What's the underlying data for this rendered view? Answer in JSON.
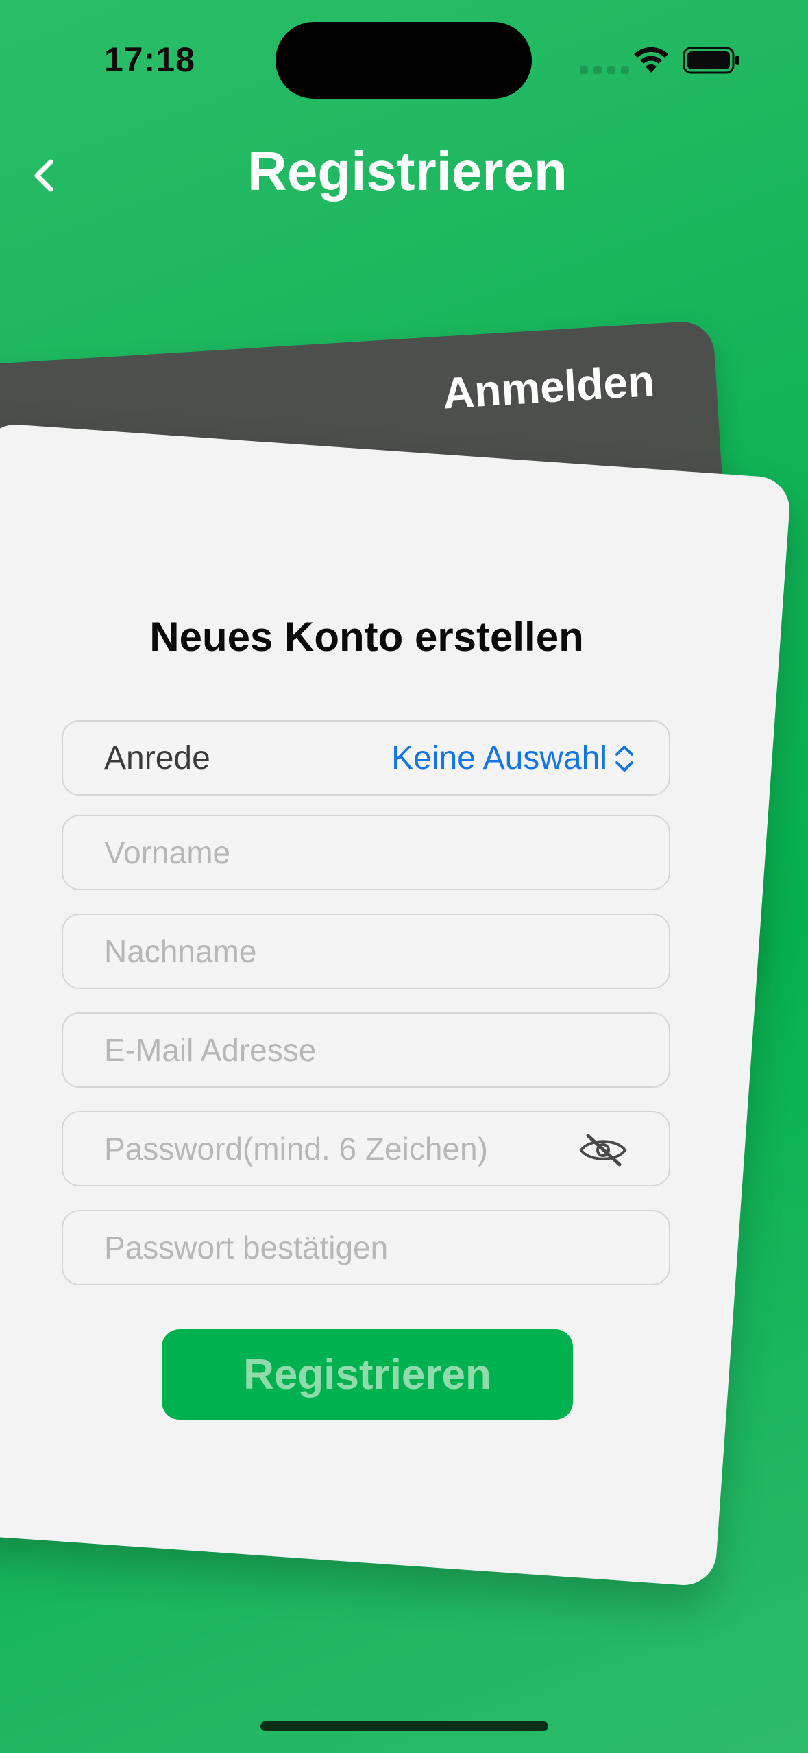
{
  "status_bar": {
    "time": "17:18"
  },
  "nav": {
    "title": "Registrieren",
    "back_icon": "chevron-left-icon"
  },
  "tabs": {
    "login_label": "Anmelden"
  },
  "form": {
    "title": "Neues Konto erstellen",
    "salutation": {
      "label": "Anrede",
      "value": "Keine Auswahl"
    },
    "first_name_placeholder": "Vorname",
    "last_name_placeholder": "Nachname",
    "email_placeholder": "E-Mail Adresse",
    "password_placeholder": "Password(mind. 6 Zeichen)",
    "password_toggle_icon": "eye-slash-icon",
    "confirm_password_placeholder": "Passwort bestätigen",
    "submit_label": "Registrieren"
  },
  "colors": {
    "background": "#0bb152",
    "accent_button": "#00b24f",
    "button_text_disabled": "#8fdbab",
    "link_blue": "#1475e6",
    "back_card": "#4c4f4c",
    "front_card": "#f3f3f3"
  }
}
